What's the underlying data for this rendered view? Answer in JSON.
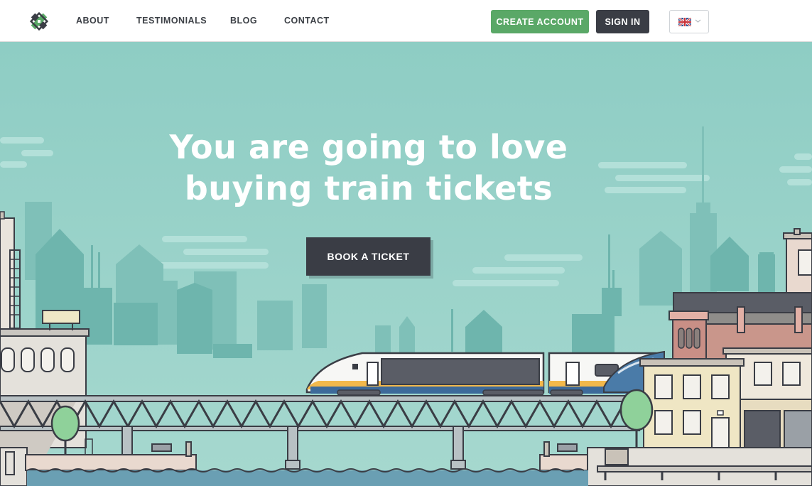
{
  "nav": {
    "links": [
      "ABOUT",
      "TESTIMONIALS",
      "BLOG",
      "CONTACT"
    ],
    "create_account": "CREATE ACCOUNT",
    "sign_in": "SIGN IN"
  },
  "hero": {
    "title_line1": "You are going to love",
    "title_line2": "buying train tickets",
    "cta": "BOOK A TICKET"
  },
  "colors": {
    "sky": "#8ecdc4",
    "create_button": "#5aa867",
    "dark_button": "#3a3d45",
    "river": "#6a9fb3"
  },
  "icons": [
    "logo-icon",
    "uk-flag-icon",
    "chevron-down-icon"
  ]
}
